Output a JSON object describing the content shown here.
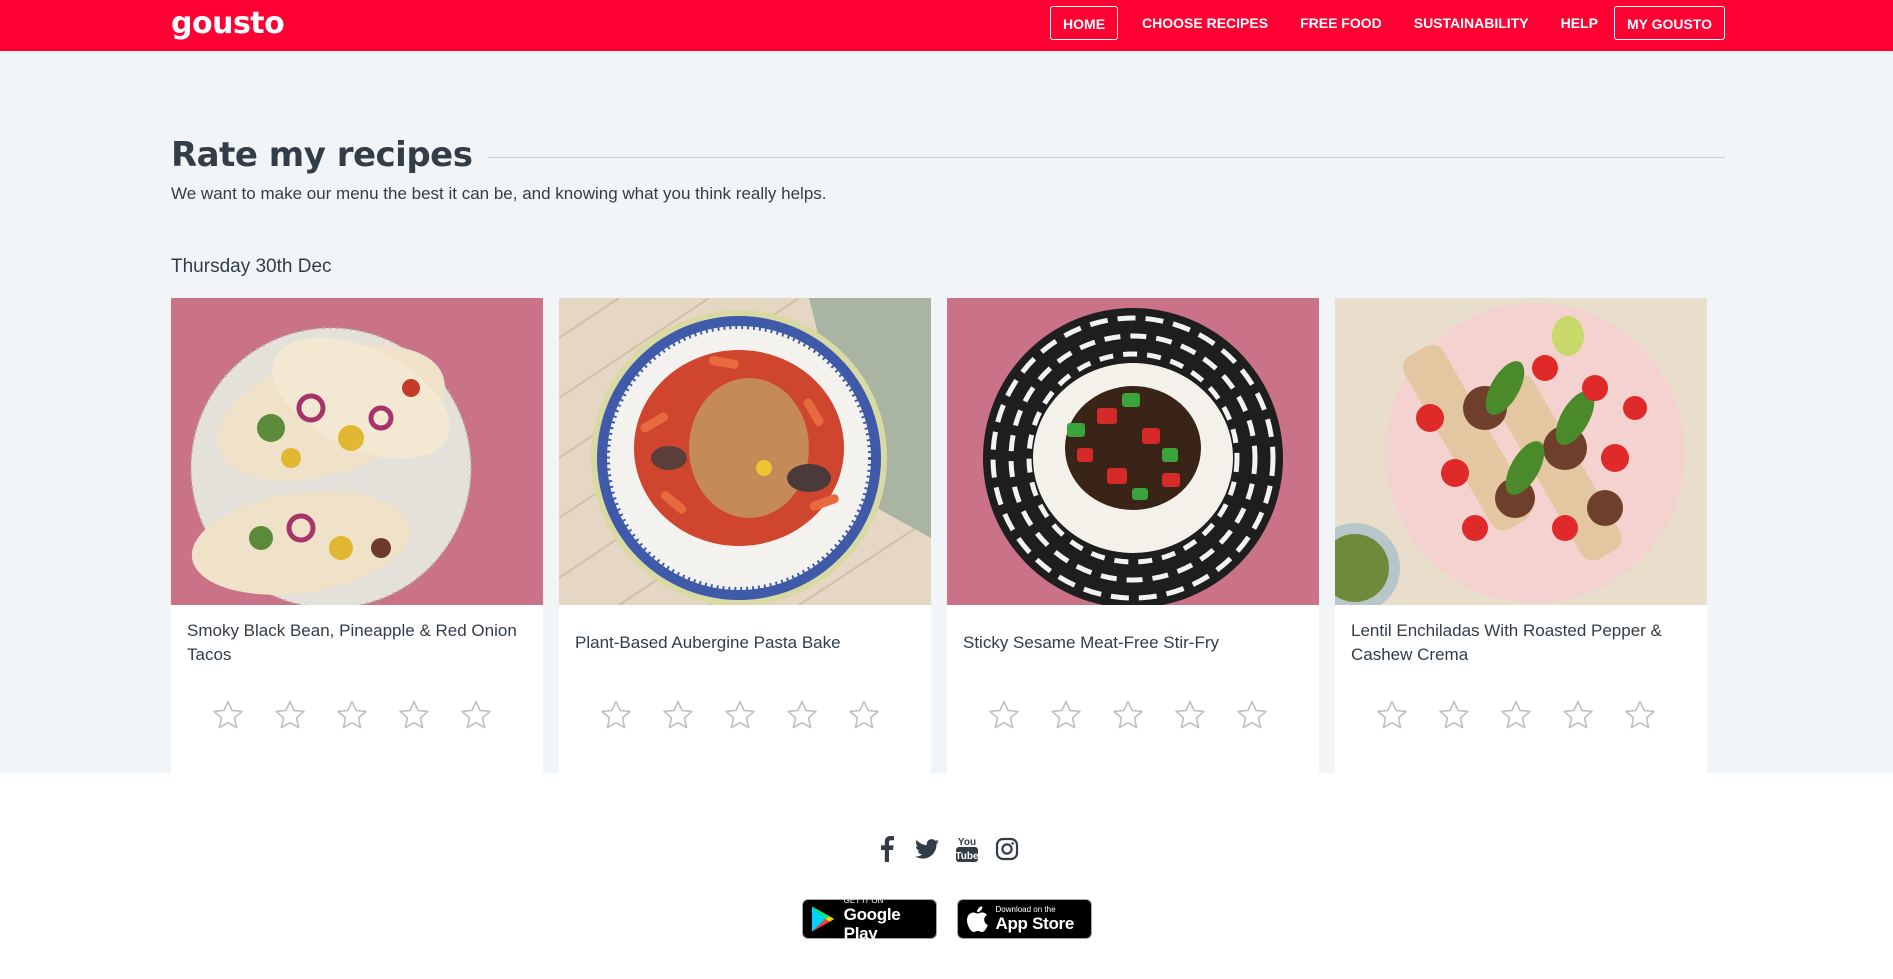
{
  "header": {
    "logo": "gousto",
    "nav": {
      "home": "HOME",
      "choose_recipes": "CHOOSE RECIPES",
      "free_food": "FREE FOOD",
      "sustainability": "SUSTAINABILITY",
      "help": "HELP",
      "my_gousto": "MY GOUSTO"
    }
  },
  "page": {
    "title": "Rate my recipes",
    "subtitle": "We want to make our menu the best it can be, and knowing what you think really helps.",
    "date": "Thursday 30th Dec"
  },
  "recipes": [
    {
      "title": "Smoky Black Bean, Pineapple & Red Onion Tacos",
      "rating": 0
    },
    {
      "title": "Plant-Based Aubergine Pasta Bake",
      "rating": 0
    },
    {
      "title": "Sticky Sesame Meat-Free Stir-Fry",
      "rating": 0
    },
    {
      "title": "Lentil Enchiladas With Roasted Pepper & Cashew Crema",
      "rating": 0
    }
  ],
  "footer": {
    "social_icons": [
      "facebook-icon",
      "twitter-icon",
      "youtube-icon",
      "instagram-icon"
    ],
    "youtube_label": "You Tube",
    "google_play": {
      "small": "GET IT ON",
      "big": "Google Play"
    },
    "app_store": {
      "small": "Download on the",
      "big": "App Store"
    }
  },
  "colors": {
    "brand_red": "#ff0033",
    "page_bg": "#f2f5f7",
    "text": "#333d47",
    "star_outline": "#b9bec3"
  }
}
